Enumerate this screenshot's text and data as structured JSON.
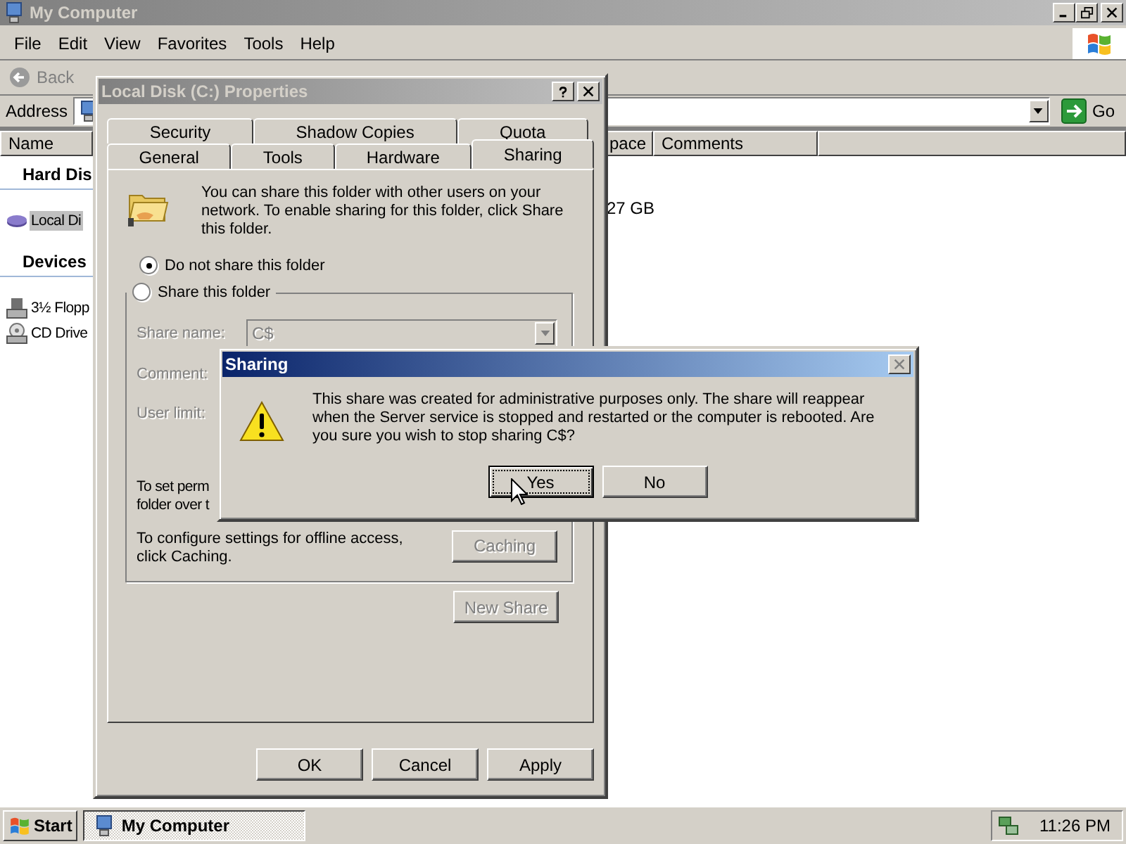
{
  "explorer": {
    "title": "My Computer",
    "active": false,
    "menu": [
      "File",
      "Edit",
      "View",
      "Favorites",
      "Tools",
      "Help"
    ],
    "back": "Back",
    "address_label": "Address",
    "go": "Go",
    "columns": [
      "Name",
      "pace",
      "Comments"
    ],
    "groups": [
      {
        "title": "Hard Dis",
        "items": [
          {
            "name": "Local Di",
            "kind": "disk",
            "selected": true
          }
        ]
      },
      {
        "title": "Devices",
        "items": [
          {
            "name": "3½ Flopp",
            "kind": "floppy",
            "selected": false
          },
          {
            "name": "CD Drive",
            "kind": "cd",
            "selected": false
          }
        ]
      }
    ],
    "free_space": "27 GB"
  },
  "properties": {
    "title": "Local Disk (C:) Properties",
    "active": false,
    "tab_rows": [
      [
        {
          "label": "Security",
          "selected": false
        },
        {
          "label": "Shadow Copies",
          "selected": false
        },
        {
          "label": "Quota",
          "selected": false
        }
      ],
      [
        {
          "label": "General",
          "selected": false
        },
        {
          "label": "Tools",
          "selected": false
        },
        {
          "label": "Hardware",
          "selected": false
        },
        {
          "label": "Sharing",
          "selected": true
        }
      ]
    ],
    "intro": "You can share this folder with other users on your network.  To enable sharing for this folder, click Share this folder.",
    "options": [
      {
        "label": "Do not share this folder",
        "checked": true
      },
      {
        "label": "Share this folder",
        "checked": false
      }
    ],
    "share_name": {
      "label": "Share name:",
      "value": "C$",
      "disabled": true
    },
    "comment_label": "Comment:",
    "user_limit_label": "User limit:",
    "permissions_lines": [
      "To set perm",
      "folder over t"
    ],
    "offline_text": "To configure settings for offline access, click Caching.",
    "caching": {
      "label": "Caching",
      "disabled": true
    },
    "new_share": {
      "label": "New Share",
      "disabled": true
    },
    "buttons": [
      {
        "label": "OK",
        "disabled": false
      },
      {
        "label": "Cancel",
        "disabled": false
      },
      {
        "label": "Apply",
        "disabled": false
      }
    ]
  },
  "message": {
    "title": "Sharing",
    "active": true,
    "text": "This share was created for administrative purposes only.  The share will reappear when the Server service is stopped and restarted or the computer is rebooted.  Are you sure you wish to stop sharing C$?",
    "buttons": [
      {
        "label": "Yes",
        "focused": true
      },
      {
        "label": "No",
        "focused": false
      }
    ]
  },
  "taskbar": {
    "start": "Start",
    "tasks": [
      {
        "label": "My Computer",
        "selected": true
      }
    ],
    "clock": "11:26 PM"
  }
}
